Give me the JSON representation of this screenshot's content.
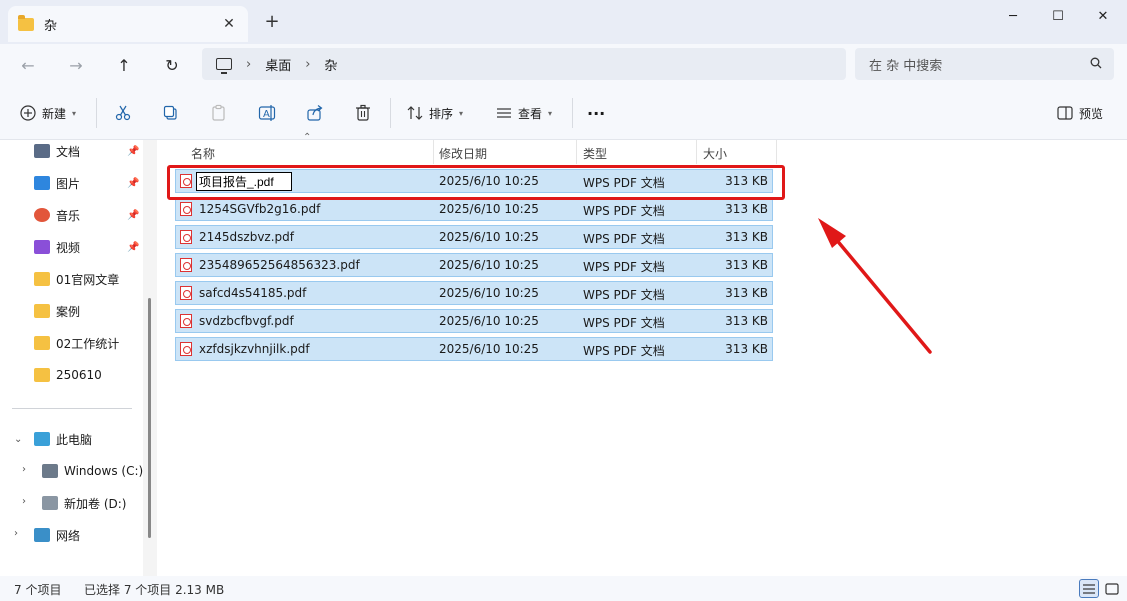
{
  "window": {
    "tab_title": "杂",
    "new_tab_label": "+",
    "minimize": "─",
    "maximize": "☐",
    "close": "✕",
    "tab_close": "✕"
  },
  "nav": {
    "back": "←",
    "forward": "→",
    "up": "↑",
    "refresh": "↻"
  },
  "address": {
    "crumbs": [
      "桌面",
      "杂"
    ],
    "sep": "›"
  },
  "search": {
    "placeholder": "在 杂 中搜索"
  },
  "toolbar": {
    "new_label": "新建",
    "sort_label": "排序",
    "view_label": "查看",
    "more_label": "···",
    "preview_label": "预览"
  },
  "sidebar": {
    "quick": [
      {
        "label": "文档",
        "icon": "document-icon",
        "color": "#5a6b86"
      },
      {
        "label": "图片",
        "icon": "pictures-icon",
        "color": "#2e86de"
      },
      {
        "label": "音乐",
        "icon": "music-icon",
        "color": "#e2563b"
      },
      {
        "label": "视频",
        "icon": "video-icon",
        "color": "#8a4fd8"
      }
    ],
    "folders": [
      "01官网文章",
      "案例",
      "02工作统计",
      "250610"
    ],
    "this_pc": "此电脑",
    "drives": [
      "Windows (C:)",
      "新加卷 (D:)"
    ],
    "network": "网络"
  },
  "columns": {
    "name": "名称",
    "date": "修改日期",
    "type": "类型",
    "size": "大小"
  },
  "files": [
    {
      "name": "项目报告_.pdf",
      "date": "2025/6/10 10:25",
      "type": "WPS PDF 文档",
      "size": "313 KB",
      "renaming": true
    },
    {
      "name": "1254SGVfb2g16.pdf",
      "date": "2025/6/10 10:25",
      "type": "WPS PDF 文档",
      "size": "313 KB"
    },
    {
      "name": "2145dszbvz.pdf",
      "date": "2025/6/10 10:25",
      "type": "WPS PDF 文档",
      "size": "313 KB"
    },
    {
      "name": "235489652564856323.pdf",
      "date": "2025/6/10 10:25",
      "type": "WPS PDF 文档",
      "size": "313 KB"
    },
    {
      "name": "safcd4s54185.pdf",
      "date": "2025/6/10 10:25",
      "type": "WPS PDF 文档",
      "size": "313 KB"
    },
    {
      "name": "svdzbcfbvgf.pdf",
      "date": "2025/6/10 10:25",
      "type": "WPS PDF 文档",
      "size": "313 KB"
    },
    {
      "name": "xzfdsjkzvhnjilk.pdf",
      "date": "2025/6/10 10:25",
      "type": "WPS PDF 文档",
      "size": "313 KB"
    }
  ],
  "status": {
    "count": "7 个项目",
    "selection": "已选择 7 个项目  2.13 MB"
  },
  "colors": {
    "selection_bg": "#cce4f7",
    "annotation_red": "#e01818",
    "folder_yellow": "#f5c142"
  }
}
